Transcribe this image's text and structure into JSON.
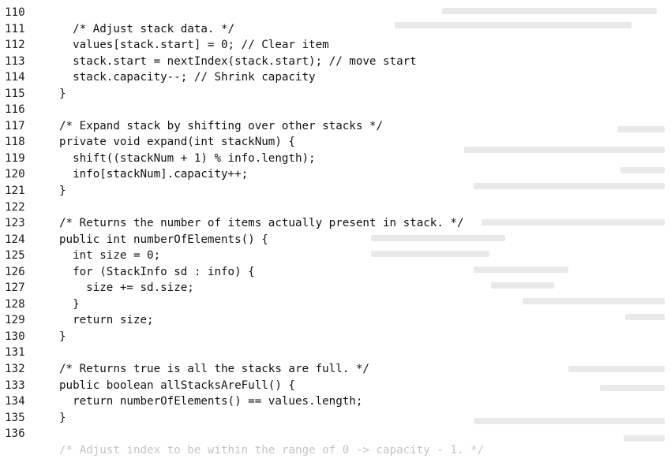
{
  "code_lines": [
    {
      "num": "110",
      "text": ""
    },
    {
      "num": "111",
      "text": "  /* Adjust stack data. */"
    },
    {
      "num": "112",
      "text": "  values[stack.start] = 0; // Clear item"
    },
    {
      "num": "113",
      "text": "  stack.start = nextIndex(stack.start); // move start"
    },
    {
      "num": "114",
      "text": "  stack.capacity--; // Shrink capacity"
    },
    {
      "num": "115",
      "text": "}"
    },
    {
      "num": "116",
      "text": ""
    },
    {
      "num": "117",
      "text": "/* Expand stack by shifting over other stacks */"
    },
    {
      "num": "118",
      "text": "private void expand(int stackNum) {"
    },
    {
      "num": "119",
      "text": "  shift((stackNum + 1) % info.length);"
    },
    {
      "num": "120",
      "text": "  info[stackNum].capacity++;"
    },
    {
      "num": "121",
      "text": "}"
    },
    {
      "num": "122",
      "text": ""
    },
    {
      "num": "123",
      "text": "/* Returns the number of items actually present in stack. */"
    },
    {
      "num": "124",
      "text": "public int numberOfElements() {"
    },
    {
      "num": "125",
      "text": "  int size = 0;"
    },
    {
      "num": "126",
      "text": "  for (StackInfo sd : info) {"
    },
    {
      "num": "127",
      "text": "    size += sd.size;"
    },
    {
      "num": "128",
      "text": "  }"
    },
    {
      "num": "129",
      "text": "  return size;"
    },
    {
      "num": "130",
      "text": "}"
    },
    {
      "num": "131",
      "text": ""
    },
    {
      "num": "132",
      "text": "/* Returns true is all the stacks are full. */"
    },
    {
      "num": "133",
      "text": "public boolean allStacksAreFull() {"
    },
    {
      "num": "134",
      "text": "  return numberOfElements() == values.length;"
    },
    {
      "num": "135",
      "text": "}"
    },
    {
      "num": "136",
      "text": ""
    },
    {
      "num": "",
      "text": "/* Adjust index to be within the range of 0 -> capacity - 1. */"
    }
  ]
}
